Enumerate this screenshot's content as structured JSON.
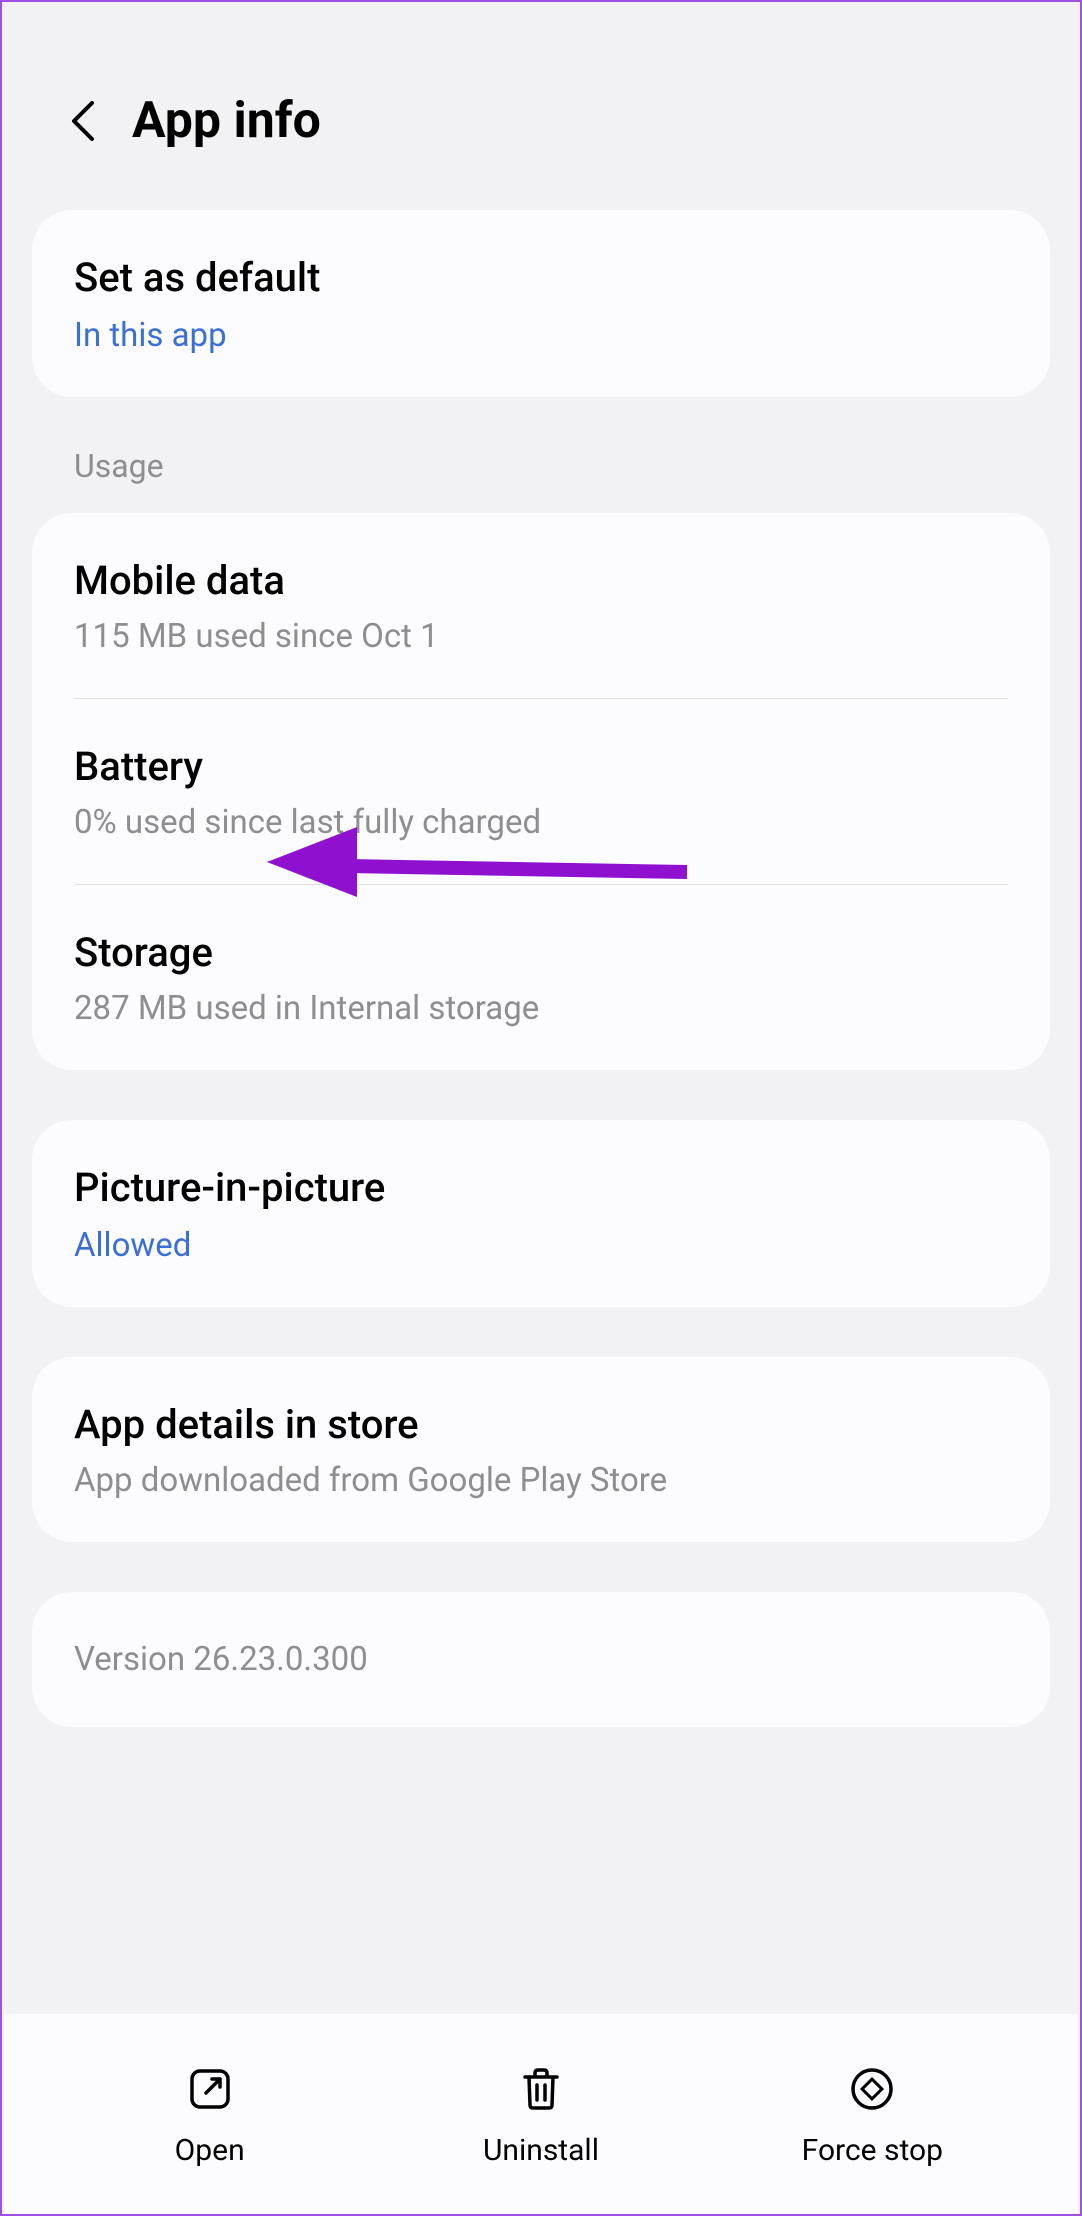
{
  "header": {
    "title": "App info"
  },
  "default_card": {
    "title": "Set as default",
    "sub": "In this app"
  },
  "usage_label": "Usage",
  "usage_card": {
    "mobile_data": {
      "title": "Mobile data",
      "sub": "115 MB used since Oct 1"
    },
    "battery": {
      "title": "Battery",
      "sub": "0% used since last fully charged"
    },
    "storage": {
      "title": "Storage",
      "sub": "287 MB used in Internal storage"
    }
  },
  "pip_card": {
    "title": "Picture-in-picture",
    "sub": "Allowed"
  },
  "store_card": {
    "title": "App details in store",
    "sub": "App downloaded from Google Play Store"
  },
  "version_card": {
    "text": "Version 26.23.0.300"
  },
  "bottom_bar": {
    "open": "Open",
    "uninstall": "Uninstall",
    "force_stop": "Force stop"
  }
}
